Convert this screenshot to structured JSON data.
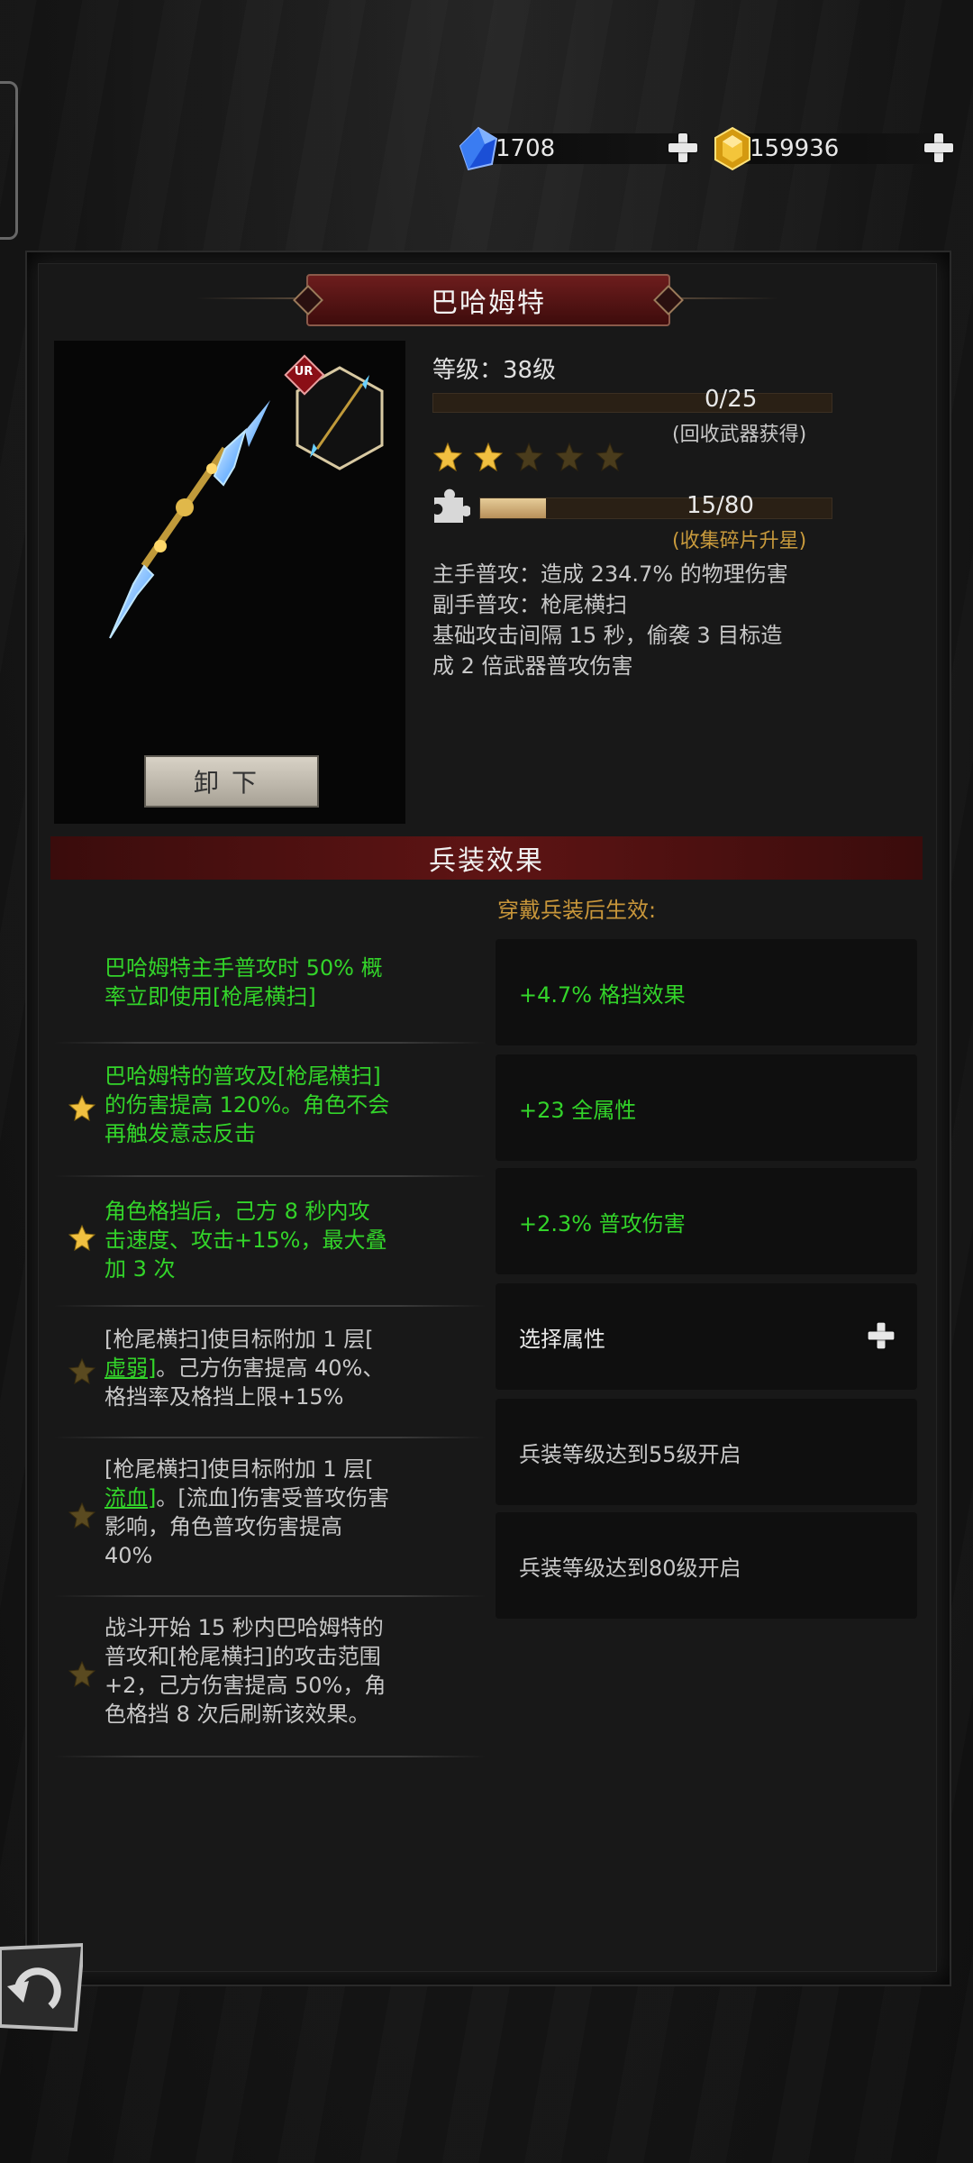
{
  "currency": {
    "gems": "1708",
    "gold": "159936"
  },
  "weapon": {
    "title": "巴哈姆特",
    "rarity_badge": "UR",
    "level_label": "等级：38级",
    "exp_progress": "0/25",
    "exp_fraction": 0.0,
    "exp_hint": "(回收武器获得)",
    "stars_filled": 2,
    "stars_total": 5,
    "shard_progress": "15/80",
    "shard_fraction": 0.1875,
    "shard_hint": "(收集碎片升星)",
    "description": [
      "主手普攻：造成 234.7% 的物理伤害",
      "副手普攻：枪尾横扫",
      "基础攻击间隔 15 秒，偷袭 3 目标造",
      "成 2 倍武器普攻伤害"
    ],
    "unload_label": "卸下"
  },
  "effects": {
    "banner": "兵装效果",
    "subtitle": "穿戴兵装后生效:",
    "list": [
      {
        "lines": [
          "巴哈姆特主手普攻时 50% 概",
          "率立即使用[枪尾横扫]"
        ]
      },
      {
        "lines": [
          "巴哈姆特的普攻及[枪尾横扫]",
          "的伤害提高 120%。角色不会",
          "再触发意志反击"
        ]
      },
      {
        "lines": [
          "角色格挡后，己方 8 秒内攻",
          "击速度、攻击+15%，最大叠",
          "加 3 次"
        ]
      },
      {
        "lines": [
          "[枪尾横扫]使目标附加 1 层[",
          "。己方伤害提高 40%、",
          "格挡率及格挡上限+15%"
        ],
        "keyword": "虚弱"
      },
      {
        "lines": [
          "[枪尾横扫]使目标附加 1 层[",
          "。[流血]伤害受普攻伤害",
          "影响，角色普攻伤害提高",
          "40%"
        ],
        "keyword": "流血"
      },
      {
        "lines": [
          "战斗开始 15 秒内巴哈姆特的",
          "普攻和[枪尾横扫]的攻击范围",
          "+2，己方伤害提高 50%，角",
          "色格挡 8 次后刷新该效果。"
        ]
      }
    ],
    "attributes": [
      "+4.7% 格挡效果",
      "+23 全属性",
      "+2.3% 普攻伤害",
      "选择属性",
      "兵装等级达到55级开启",
      "兵装等级达到80级开启"
    ]
  },
  "colors": {
    "green_text": "#33d42a",
    "gold_text": "#c8963a",
    "banner_red": "#5e1414"
  },
  "icons": [
    "blue-gem-icon",
    "gold-coin-icon",
    "plus-icon",
    "star-icon",
    "puzzle-piece-icon",
    "back-arrow-icon"
  ]
}
